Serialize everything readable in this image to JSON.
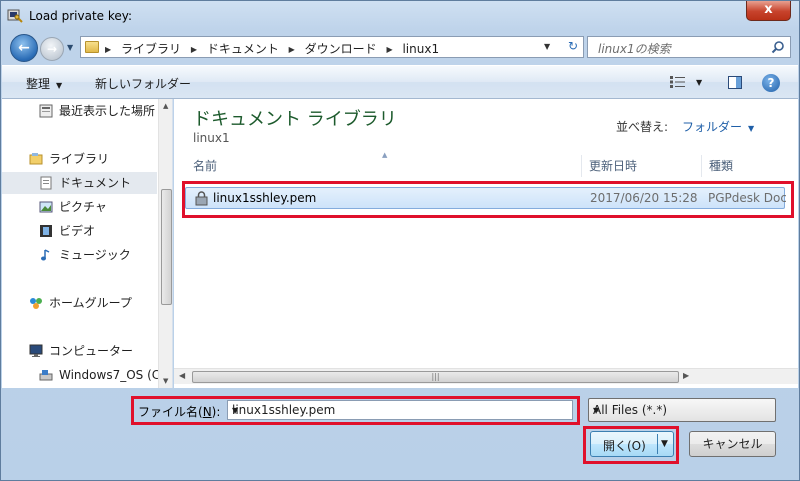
{
  "window": {
    "title": "Load private key:",
    "close_label": "x"
  },
  "address": {
    "crumbs": [
      "ライブラリ",
      "ドキュメント",
      "ダウンロード",
      "linux1"
    ],
    "search_placeholder": "linux1の検索"
  },
  "toolbar": {
    "organize_label": "整理",
    "new_folder_label": "新しいフォルダー",
    "help_label": "?"
  },
  "nav": {
    "items": [
      {
        "label": "最近表示した場所",
        "icon": "recent-places-icon"
      },
      {
        "label": "ライブラリ",
        "icon": "library-icon"
      },
      {
        "label": "ドキュメント",
        "icon": "documents-icon",
        "selected": true
      },
      {
        "label": "ピクチャ",
        "icon": "pictures-icon"
      },
      {
        "label": "ビデオ",
        "icon": "videos-icon"
      },
      {
        "label": "ミュージック",
        "icon": "music-icon"
      },
      {
        "label": "ホームグループ",
        "icon": "homegroup-icon"
      },
      {
        "label": "コンピューター",
        "icon": "computer-icon"
      },
      {
        "label": "Windows7_OS (C",
        "icon": "drive-icon"
      }
    ]
  },
  "content": {
    "library_title": "ドキュメント ライブラリ",
    "library_subtitle": "linux1",
    "sort_label": "並べ替え:",
    "sort_value": "フォルダー",
    "columns": {
      "name": "名前",
      "modified": "更新日時",
      "type": "種類"
    },
    "files": [
      {
        "name": "linux1sshley.pem",
        "modified": "2017/06/20 15:28",
        "type": "PGPdesk Docu",
        "selected": true
      }
    ]
  },
  "bottom": {
    "filename_label_prefix": "ファイル名(",
    "filename_label_key": "N",
    "filename_label_suffix": "):",
    "filename_value": "linux1sshley.pem",
    "filter_value": "All Files (*.*)",
    "open_label": "開く(O)",
    "cancel_label": "キャンセル"
  },
  "colors": {
    "annotation_red": "#e0102b",
    "library_title": "#1c5a2c",
    "accent_blue": "#1f5fa8"
  }
}
